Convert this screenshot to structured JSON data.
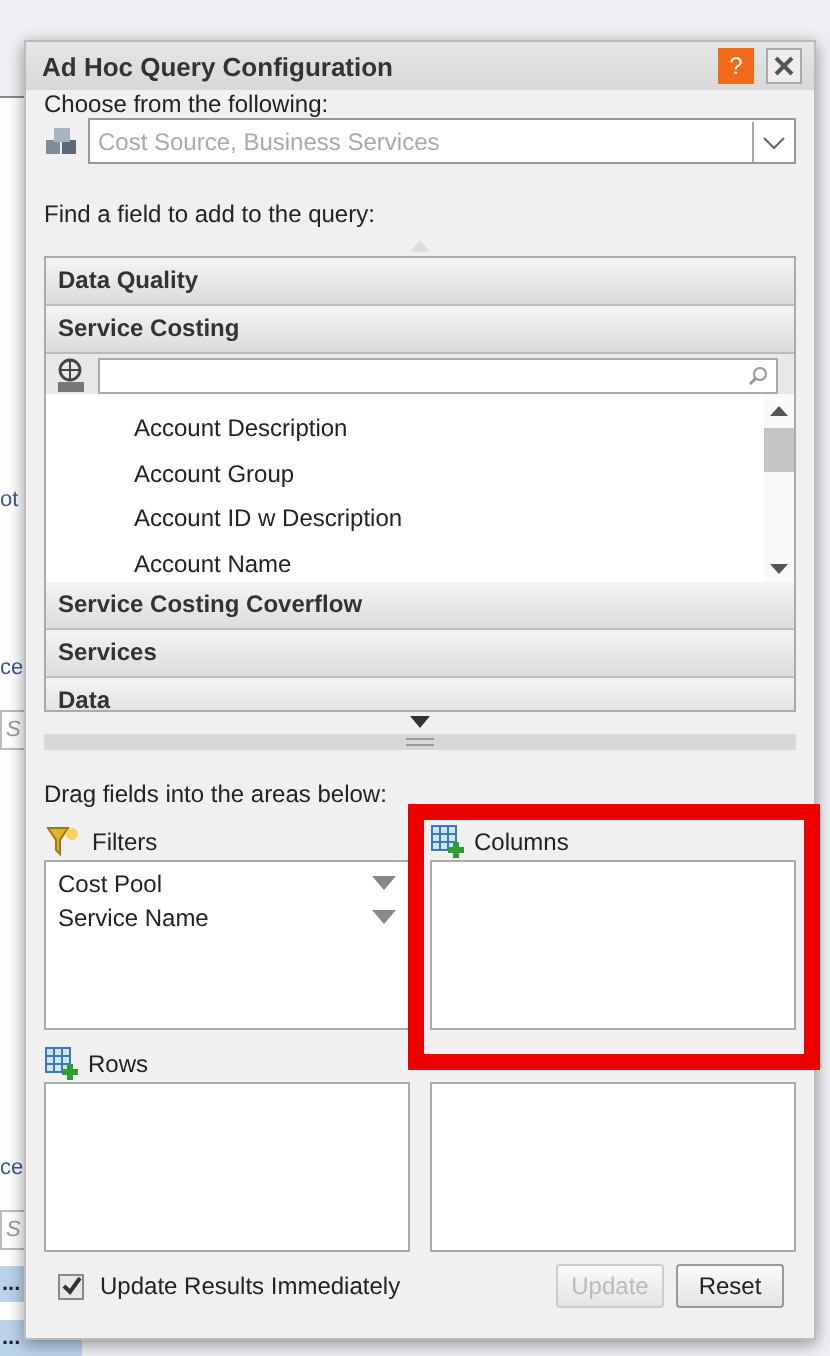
{
  "background": {
    "fragments": [
      {
        "text": "ot",
        "kind": "link"
      },
      {
        "text": "ce",
        "kind": "link"
      },
      {
        "text": "S",
        "kind": "field"
      },
      {
        "text": "ce",
        "kind": "link"
      },
      {
        "text": "S",
        "kind": "field"
      },
      {
        "text": "...",
        "kind": "row"
      },
      {
        "text": "...",
        "kind": "row"
      }
    ]
  },
  "dialog": {
    "title": "Ad Hoc Query Configuration",
    "help": "?",
    "source_label": "Choose from the following:",
    "source_value": "Cost Source, Business Services",
    "find_label": "Find a field to add to the query:",
    "groups": [
      {
        "name": "Data Quality"
      },
      {
        "name": "Service Costing",
        "items": [
          "Account Description",
          "Account Group",
          "Account ID w Description",
          "Account Name"
        ]
      },
      {
        "name": "Service Costing Coverflow"
      },
      {
        "name": "Services"
      },
      {
        "name": "Data"
      }
    ],
    "drag_label": "Drag fields into the areas below:",
    "areas": [
      {
        "label": "Filters",
        "kind": "filters",
        "fields": [
          "Cost Pool",
          "Service Name"
        ]
      },
      {
        "label": "Columns",
        "kind": "columns"
      },
      {
        "label": "Rows",
        "kind": "rows"
      },
      {
        "kind": "values"
      }
    ],
    "update_immediately": {
      "label": "Update Results Immediately",
      "checked": true
    },
    "buttons": [
      {
        "label": "Update",
        "disabled": true
      },
      {
        "label": "Reset",
        "disabled": false
      }
    ]
  },
  "highlight": {
    "shown": true
  }
}
